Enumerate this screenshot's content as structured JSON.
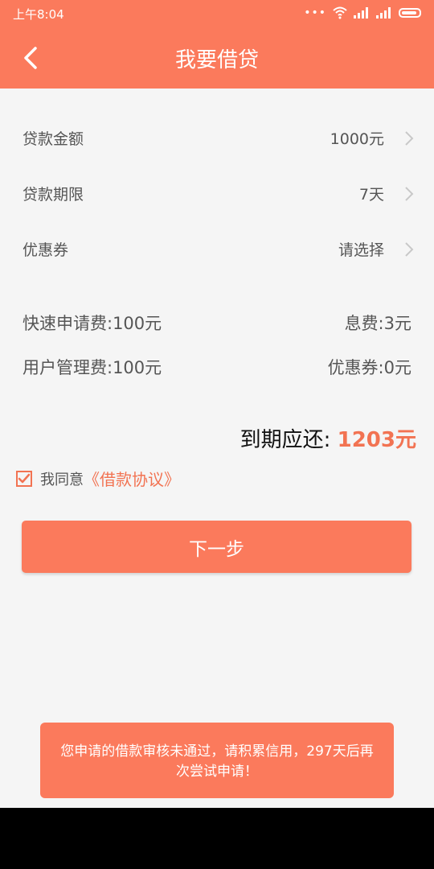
{
  "status_bar": {
    "time": "上午8:04",
    "icons": [
      "dots-icon",
      "wifi-icon",
      "signal-icon",
      "signal-icon",
      "battery-icon"
    ]
  },
  "header": {
    "title": "我要借贷",
    "back_icon": "back-arrow-icon"
  },
  "form": {
    "rows": [
      {
        "label": "贷款金额",
        "value": "1000元"
      },
      {
        "label": "贷款期限",
        "value": "7天"
      },
      {
        "label": "优惠券",
        "value": "请选择"
      }
    ]
  },
  "fees": {
    "quick_fee": "快速申请费:100元",
    "interest_fee": "息费:3元",
    "management_fee": "用户管理费:100元",
    "coupon_fee": "优惠券:0元"
  },
  "due": {
    "label": "到期应还:",
    "amount": "1203元"
  },
  "agreement": {
    "checked": true,
    "text": "我同意",
    "link": "《借款协议》"
  },
  "next_button": {
    "label": "下一步"
  },
  "toast": {
    "message": "您申请的借款审核未通过，请积累信用，297天后再次尝试申请！"
  },
  "colors": {
    "accent": "#fb7a5c",
    "highlight": "#f27352",
    "background": "#f5f5f5"
  }
}
